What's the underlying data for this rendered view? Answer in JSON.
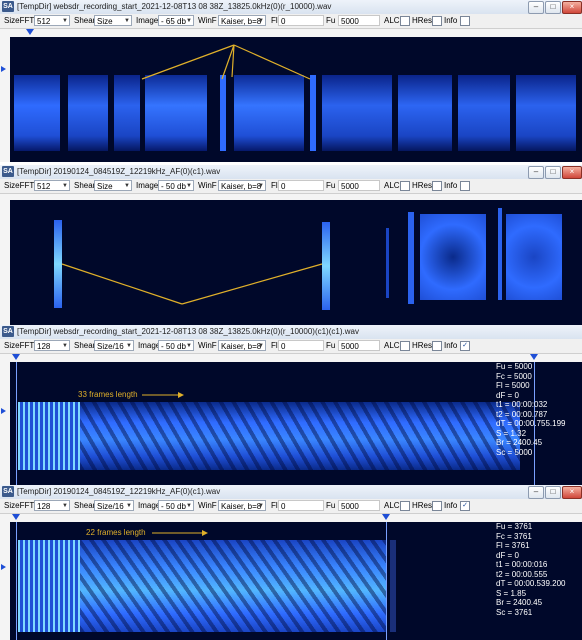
{
  "windows": [
    {
      "title": "[TempDir] websdr_recording_start_2021-12-08T13 08 38Z_13825.0kHz(0)(r_10000).wav",
      "toolbar": {
        "sizefft_label": "SizeFFT",
        "sizefft_value": "512",
        "shear_label": "Shear",
        "shear_value": "Size",
        "image_label": "Image",
        "image_value": "- 65 db",
        "winf_label": "WinF",
        "winf_value": "Kaiser, b=8",
        "fl_label": "Fl",
        "fl_value": "0",
        "fu_label": "Fu",
        "fu_value": "5000",
        "alc_label": "ALC",
        "hres_label": "HRes",
        "info_label": "Info",
        "info_checked": false
      }
    },
    {
      "title": "[TempDir] 20190124_084519Z_12219kHz_AF(0)(c1).wav",
      "toolbar": {
        "sizefft_label": "SizeFFT",
        "sizefft_value": "512",
        "shear_label": "Shear",
        "shear_value": "Size",
        "image_label": "Image",
        "image_value": "- 50 db",
        "winf_label": "WinF",
        "winf_value": "Kaiser, b=8",
        "fl_label": "Fl",
        "fl_value": "0",
        "fu_label": "Fu",
        "fu_value": "5000",
        "alc_label": "ALC",
        "hres_label": "HRes",
        "info_label": "Info",
        "info_checked": false
      }
    },
    {
      "title": "[TempDir] websdr_recording_start_2021-12-08T13 08 38Z_13825.0kHz(0)(r_10000)(c1)(c1).wav",
      "toolbar": {
        "sizefft_label": "SizeFFT",
        "sizefft_value": "128",
        "shear_label": "Shear",
        "shear_value": "Size/16",
        "image_label": "Image",
        "image_value": "- 50 db",
        "winf_label": "WinF",
        "winf_value": "Kaiser, b=8",
        "fl_label": "Fl",
        "fl_value": "0",
        "fu_label": "Fu",
        "fu_value": "5000",
        "alc_label": "ALC",
        "hres_label": "HRes",
        "info_label": "Info",
        "info_checked": true
      },
      "annotation": "33 frames length",
      "info_lines": [
        "Fu = 5000",
        "Fc = 5000",
        "Fl = 5000",
        "dF = 0",
        "t1 = 00:00:032",
        "t2 = 00:00.787",
        "dT = 00:00.755.199",
        "S = 1.32",
        "Br = 2400.45",
        "Sc = 5000"
      ]
    },
    {
      "title": "[TempDir] 20190124_084519Z_12219kHz_AF(0)(c1).wav",
      "toolbar": {
        "sizefft_label": "SizeFFT",
        "sizefft_value": "128",
        "shear_label": "Shear",
        "shear_value": "Size/16",
        "image_label": "Image",
        "image_value": "- 50 db",
        "winf_label": "WinF",
        "winf_value": "Kaiser, b=8",
        "fl_label": "Fl",
        "fl_value": "0",
        "fu_label": "Fu",
        "fu_value": "5000",
        "alc_label": "ALC",
        "hres_label": "HRes",
        "info_label": "Info",
        "info_checked": true
      },
      "annotation": "22 frames length",
      "info_lines": [
        "Fu = 3761",
        "Fc = 3761",
        "Fl = 3761",
        "dF = 0",
        "t1 = 00:00:016",
        "t2 = 00:00.555",
        "dT = 00:00.539.200",
        "S = 1.85",
        "Br = 2400.45",
        "Sc = 3761"
      ]
    }
  ],
  "window_controls": {
    "minimize": "–",
    "maximize": "□",
    "close": "×"
  },
  "app_icon": "SA",
  "icons": [
    "app-icon",
    "minimize-icon",
    "maximize-icon",
    "close-icon",
    "dropdown-arrow-icon",
    "cursor-marker-icon"
  ],
  "colors": {
    "spectrogram_bg": "#00082a",
    "signal": "#2f6bff",
    "signal_hot": "#7fd8ff",
    "annotation": "#e0b02a",
    "marker": "#1f4fd6"
  }
}
